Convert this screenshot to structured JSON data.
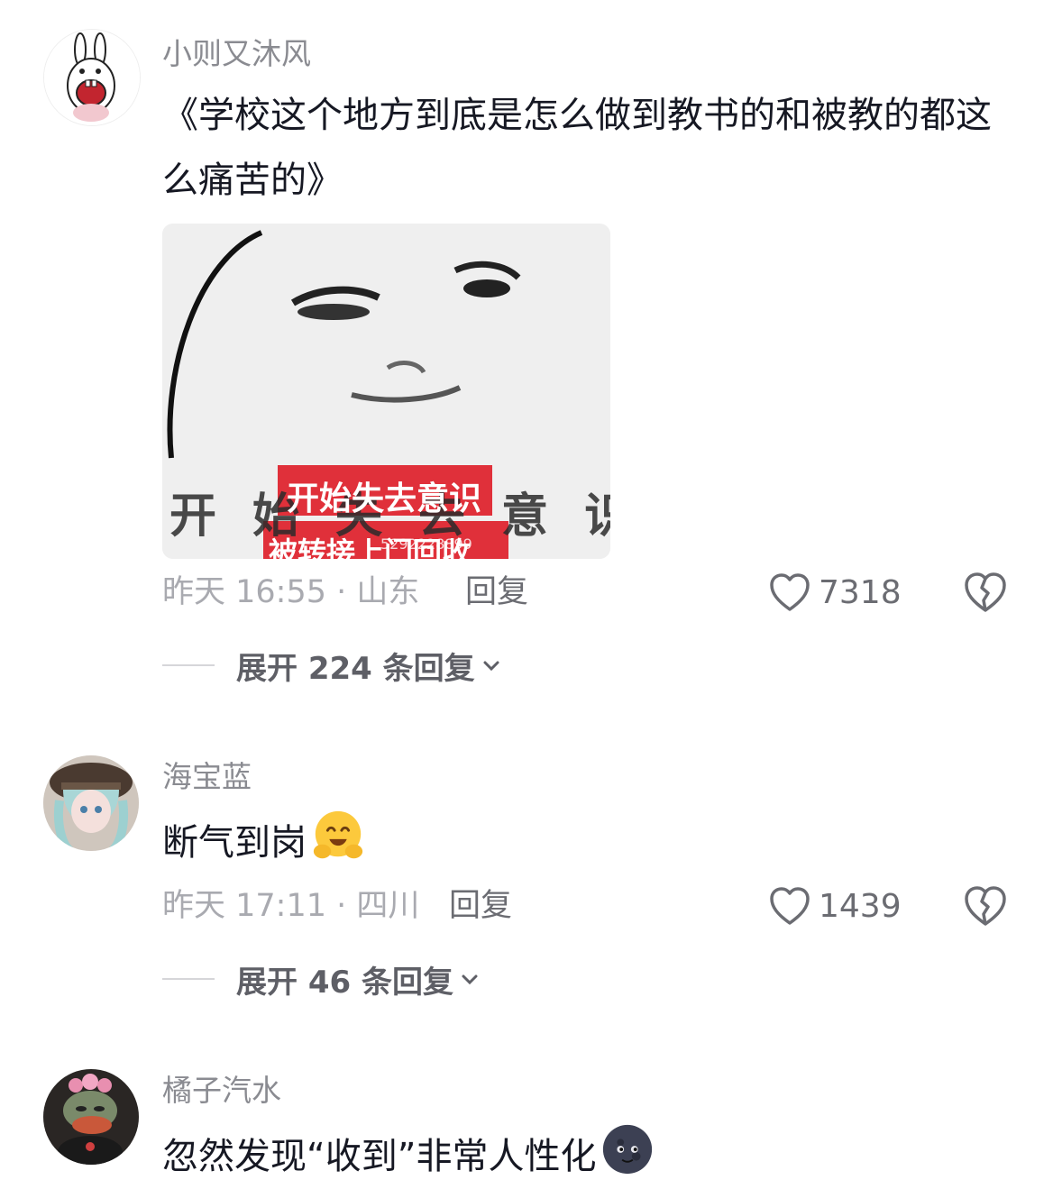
{
  "comments": [
    {
      "username": "小则又沐风",
      "text": "《学校这个地方到底是怎么做到教书的和被教的都这么痛苦的》",
      "image": {
        "caption_red": "开始失去意识",
        "caption_bg": "开始失去意识",
        "caption_bottom": "被转接上门回收",
        "watermark": "5292228899"
      },
      "meta": "昨天 16:55 · 山东",
      "reply_label": "回复",
      "likes": "7318",
      "expand_label": "展开 224 条回复"
    },
    {
      "username": "海宝蓝",
      "text": "断气到岗",
      "emoji": "hugging-face-emoji",
      "meta": "昨天 17:11 · 四川",
      "reply_label": "回复",
      "likes": "1439",
      "expand_label": "展开 46 条回复"
    },
    {
      "username": "橘子汽水",
      "text": "忽然发现“收到”非常人性化",
      "emoji": "new-moon-face-emoji"
    }
  ],
  "colors": {
    "username": "#8a8b91",
    "meta": "#a9aab0",
    "body_text": "#161823",
    "sticker_red": "#e0303a"
  }
}
